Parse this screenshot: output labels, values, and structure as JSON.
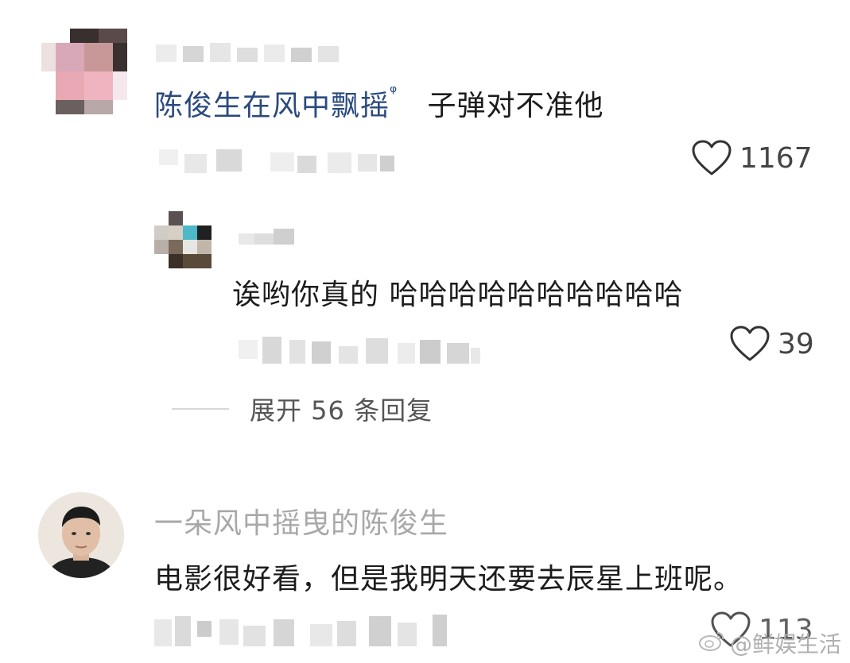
{
  "comments": [
    {
      "text_link": "陈俊生在风中飘摇",
      "search_glyph": "ᵠ",
      "text_rest": "子弹对不准他",
      "likes": "1167"
    },
    {
      "text": "诶哟你真的 哈哈哈哈哈哈哈哈哈哈",
      "likes": "39"
    },
    {
      "username": "一朵风中摇曳的陈俊生",
      "text": "电影很好看，但是我明天还要去辰星上班呢。",
      "likes": "113"
    }
  ],
  "expand_replies": "展开 56 条回复",
  "watermark": {
    "icon": "weibo-icon",
    "text": "@鲜娱生活"
  },
  "colors": {
    "link": "#2a4a7f",
    "gray_username": "#a8a8a8",
    "text": "#1c1c1c"
  }
}
